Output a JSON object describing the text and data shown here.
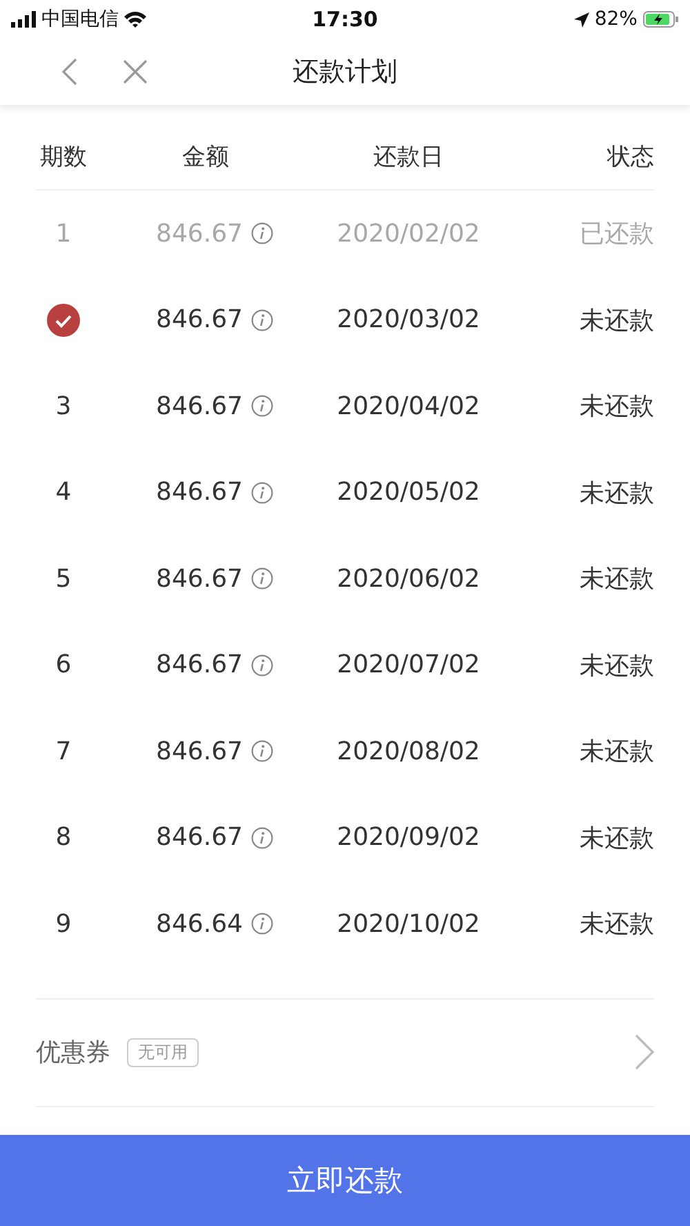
{
  "status_bar": {
    "carrier": "中国电信",
    "time": "17:30",
    "battery": "82%"
  },
  "nav": {
    "title": "还款计划"
  },
  "table": {
    "columns": [
      "期数",
      "金额",
      "还款日",
      "状态"
    ],
    "rows": [
      {
        "period": "1",
        "amount": "846.67",
        "date": "2020/02/02",
        "status": "已还款",
        "paid": true,
        "selected": false
      },
      {
        "amount": "846.67",
        "date": "2020/03/02",
        "status": "未还款",
        "paid": false,
        "selected": true
      },
      {
        "period": "3",
        "amount": "846.67",
        "date": "2020/04/02",
        "status": "未还款",
        "paid": false,
        "selected": false
      },
      {
        "period": "4",
        "amount": "846.67",
        "date": "2020/05/02",
        "status": "未还款",
        "paid": false,
        "selected": false
      },
      {
        "period": "5",
        "amount": "846.67",
        "date": "2020/06/02",
        "status": "未还款",
        "paid": false,
        "selected": false
      },
      {
        "period": "6",
        "amount": "846.67",
        "date": "2020/07/02",
        "status": "未还款",
        "paid": false,
        "selected": false
      },
      {
        "period": "7",
        "amount": "846.67",
        "date": "2020/08/02",
        "status": "未还款",
        "paid": false,
        "selected": false
      },
      {
        "period": "8",
        "amount": "846.67",
        "date": "2020/09/02",
        "status": "未还款",
        "paid": false,
        "selected": false
      },
      {
        "period": "9",
        "amount": "846.64",
        "date": "2020/10/02",
        "status": "未还款",
        "paid": false,
        "selected": false
      }
    ]
  },
  "coupon": {
    "label": "优惠券",
    "badge": "无可用"
  },
  "action_button": "立即还款"
}
